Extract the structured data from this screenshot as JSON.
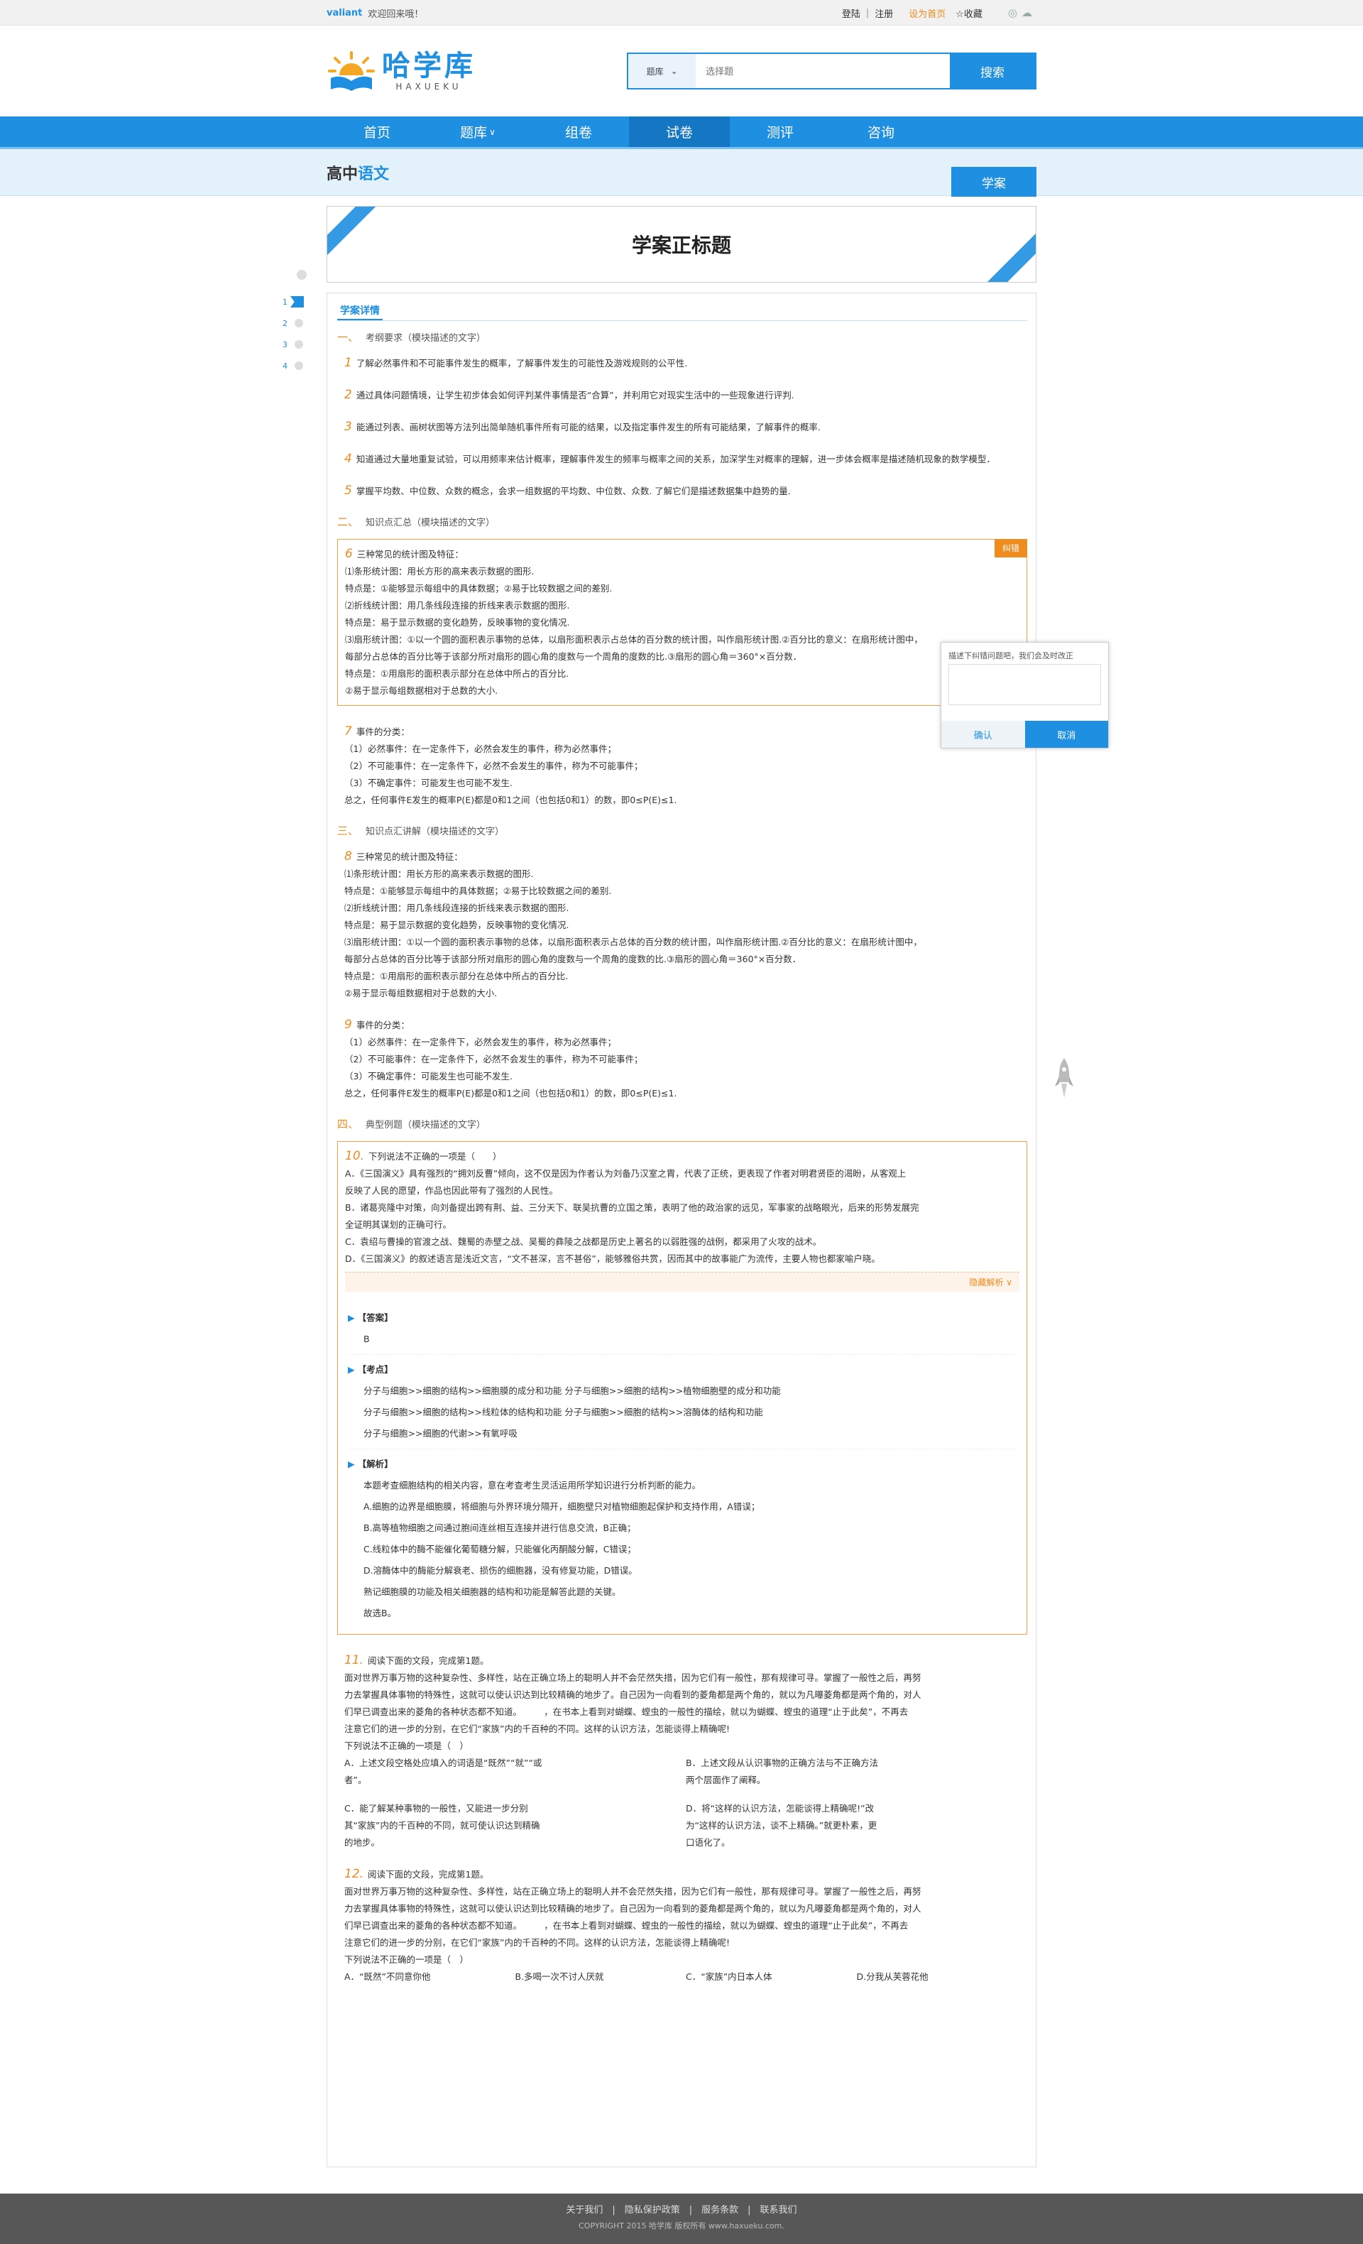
{
  "topbar": {
    "username": "valiant",
    "welcome": "欢迎回来哦！",
    "login": "登陆",
    "register": "注册",
    "set_home": "设为首页",
    "favorite": "☆收藏"
  },
  "logo": {
    "cn": "哈学库",
    "en": "HAXUEKU"
  },
  "search": {
    "type": "题库",
    "placeholder": "选择题",
    "button": "搜索"
  },
  "nav": [
    "首页",
    "题库",
    "组卷",
    "试卷",
    "测评",
    "咨询"
  ],
  "subbar": {
    "crumb_main": "高中",
    "crumb_sub": "语文",
    "tab": "学案"
  },
  "page_title": "学案正标题",
  "section_tab": "学案详情",
  "sections": {
    "s1": {
      "num": "一、",
      "text": "考纲要求（模块描述的文字）"
    },
    "s2": {
      "num": "二、",
      "text": "知识点汇总（模块描述的文字）"
    },
    "s3": {
      "num": "三、",
      "text": "知识点汇讲解（模块描述的文字）"
    },
    "s4": {
      "num": "四、",
      "text": "典型例题（模块描述的文字）"
    }
  },
  "req": [
    {
      "n": "1",
      "t": "了解必然事件和不可能事件发生的概率，了解事件发生的可能性及游戏规则的公平性."
    },
    {
      "n": "2",
      "t": "通过具体问题情境，让学生初步体会如何评判某件事情是否“合算”，并利用它对现实生活中的一些现象进行评判."
    },
    {
      "n": "3",
      "t": "能通过列表、画树状图等方法列出简单随机事件所有可能的结果，以及指定事件发生的所有可能结果，了解事件的概率."
    },
    {
      "n": "4",
      "t": "知道通过大量地重复试验，可以用频率来估计概率，理解事件发生的频率与概率之间的关系，加深学生对概率的理解，进一步体会概率是描述随机现象的数学模型．"
    },
    {
      "n": "5",
      "t": "掌握平均数、中位数、众数的概念，会求一组数据的平均数、中位数、众数. 了解它们是描述数据集中趋势的量."
    }
  ],
  "kp6": {
    "n": "6",
    "lines": [
      "三种常见的统计图及特征：",
      "⑴条形统计图：用长方形的高来表示数据的图形.",
      "特点是：①能够显示每组中的具体数据；②易于比较数据之间的差别.",
      "⑵折线统计图：用几条线段连接的折线来表示数据的图形.",
      "特点是：易于显示数据的变化趋势，反映事物的变化情况.",
      "⑶扇形统计图：①以一个圆的面积表示事物的总体，以扇形面积表示占总体的百分数的统计图，叫作扇形统计图.②百分比的意义：在扇形统计图中，",
      "每部分占总体的百分比等于该部分所对扇形的圆心角的度数与一个周角的度数的比.③扇形的圆心角＝360°×百分数．",
      "特点是：①用扇形的面积表示部分在总体中所占的百分比.",
      "②易于显示每组数据相对于总数的大小."
    ]
  },
  "correct_tag": "纠错",
  "popup": {
    "text": "描述下纠错问题吧，我们会及时改正",
    "ok": "确认",
    "cancel": "取消"
  },
  "kp7": {
    "n": "7",
    "lines": [
      "事件的分类：",
      "（1）必然事件：在一定条件下，必然会发生的事件，称为必然事件；",
      "（2）不可能事件：在一定条件下，必然不会发生的事件，称为不可能事件；",
      "（3）不确定事件：可能发生也可能不发生.",
      "总之，任何事件E发生的概率P(E)都是0和1之间（也包括0和1）的数，即0≤P(E)≤1."
    ]
  },
  "kp8": {
    "n": "8",
    "lines": [
      "三种常见的统计图及特征：",
      "⑴条形统计图：用长方形的高来表示数据的图形.",
      "特点是：①能够显示每组中的具体数据；②易于比较数据之间的差别.",
      "⑵折线统计图：用几条线段连接的折线来表示数据的图形.",
      "特点是：易于显示数据的变化趋势，反映事物的变化情况.",
      "⑶扇形统计图：①以一个圆的面积表示事物的总体，以扇形面积表示占总体的百分数的统计图，叫作扇形统计图.②百分比的意义：在扇形统计图中，",
      "每部分占总体的百分比等于该部分所对扇形的圆心角的度数与一个周角的度数的比.③扇形的圆心角＝360°×百分数．",
      "特点是：①用扇形的面积表示部分在总体中所占的百分比.",
      "②易于显示每组数据相对于总数的大小."
    ]
  },
  "kp9": {
    "n": "9",
    "lines": [
      "事件的分类：",
      "（1）必然事件：在一定条件下，必然会发生的事件，称为必然事件；",
      "（2）不可能事件：在一定条件下，必然不会发生的事件，称为不可能事件；",
      "（3）不确定事件：可能发生也可能不发生.",
      "总之，任何事件E发生的概率P(E)都是0和1之间（也包括0和1）的数，即0≤P(E)≤1."
    ]
  },
  "q10": {
    "n": "10.",
    "stem": "下列说法不正确的一项是（　　）",
    "lines": [
      "A．《三国演义》具有强烈的“拥刘反曹”倾向，这不仅是因为作者认为刘备乃汉室之胄，代表了正统，更表现了作者对明君贤臣的渴盼，从客观上",
      "反映了人民的愿望，作品也因此带有了强烈的人民性。",
      "B．诸葛亮隆中对策，向刘备提出跨有荆、益、三分天下、联吴抗曹的立国之策，表明了他的政治家的远见，军事家的战略眼光，后来的形势发展完",
      "全证明其谋划的正确可行。",
      "C．袁绍与曹操的官渡之战、魏蜀的赤壁之战、吴蜀的彝陵之战都是历史上著名的以弱胜强的战例，都采用了火攻的战术。",
      "D．《三国演义》的叙述语言是浅近文言，“文不甚深，言不甚俗”，能够雅俗共赏，因而其中的故事能广为流传，主要人物也都家喻户晓。"
    ],
    "toggle": "隐藏解析 ∨",
    "answer_head": "【答案】",
    "answer": "B",
    "point_head": "【考点】",
    "points": [
      "分子与细胞>>细胞的结构>>细胞膜的成分和功能 分子与细胞>>细胞的结构>>植物细胞壁的成分和功能",
      "分子与细胞>>细胞的结构>>线粒体的结构和功能 分子与细胞>>细胞的结构>>溶酶体的结构和功能",
      "分子与细胞>>细胞的代谢>>有氧呼吸"
    ],
    "analysis_head": "【解析】",
    "analysis": [
      "本题考查细胞结构的相关内容，意在考查考生灵活运用所学知识进行分析判断的能力。",
      "A.细胞的边界是细胞膜，将细胞与外界环境分隔开，细胞壁只对植物细胞起保护和支持作用，A错误；",
      "B.高等植物细胞之间通过胞间连丝相互连接并进行信息交流，B正确；",
      "C.线粒体中的酶不能催化葡萄糖分解，只能催化丙酮酸分解，C错误；",
      "D.溶酶体中的酶能分解衰老、损伤的细胞器，没有修复功能，D错误。",
      "熟记细胞膜的功能及相关细胞器的结构和功能是解答此题的关键。",
      "故选B。"
    ]
  },
  "q11": {
    "n": "11.",
    "stem": "阅读下面的文段，完成第1题。",
    "para": [
      "面对世界万事万物的这种复杂性、多样性，站在正确立场上的聪明人并不会茫然失措，因为它们有一般性，那有规律可寻。掌握了一般性之后，再努",
      "力去掌握具体事物的特殊性，这就可以使认识达到比较精确的地步了。自己因为一向看到的菱角都是两个角的，就以为凡曝菱角都是两个角的，对人",
      "们早已调查出来的菱角的各种状态都不知道。　　　，在书本上看到对蝴蝶、螳虫的一般性的描绘，就以为蝴蝶、螳虫的道理“止于此矣”，不再去",
      "注意它们的进一步的分别，在它们“家族”内的千百种的不同。这样的认识方法，怎能谈得上精确呢!"
    ],
    "question": "下列说法不正确的一项是（　）",
    "opts": [
      "A．上述文段空格处应填入的词语是“既然”“就”“或者”。",
      "B．上述文段从认识事物的正确方法与不正确方法两个层面作了阐释。",
      "C．能了解某种事物的一般性，又能进一步分别其“家族”内的千百种的不同，就可使认识达到精确的地步。",
      "D．将“这样的认识方法，怎能谈得上精确呢!”改为“这样的认识方法，谈不上精确。”就更朴素，更口语化了。"
    ]
  },
  "q12": {
    "n": "12.",
    "stem": "阅读下面的文段，完成第1题。",
    "para": [
      "面对世界万事万物的这种复杂性、多样性，站在正确立场上的聪明人并不会茫然失措，因为它们有一般性，那有规律可寻。掌握了一般性之后，再努",
      "力去掌握具体事物的特殊性，这就可以使认识达到比较精确的地步了。自己因为一向看到的菱角都是两个角的，就以为凡曝菱角都是两个角的，对人",
      "们早已调查出来的菱角的各种状态都不知道。　　　，在书本上看到对蝴蝶、螳虫的一般性的描绘，就以为蝴蝶、螳虫的道理“止于此矣”，不再去",
      "注意它们的进一步的分别，在它们“家族”内的千百种的不同。这样的认识方法，怎能谈得上精确呢!"
    ],
    "question": "下列说法不正确的一项是（　）",
    "opts": [
      "A．“既然”不同意你他",
      "B.多喝一次不讨人厌就",
      "C．“家族”内日本人体",
      "D.分我从芙蓉花他"
    ]
  },
  "side_nav": [
    "1",
    "2",
    "3",
    "4"
  ],
  "footer": {
    "links": "关于我们　|　隐私保护政策　|　服务条款　|　联系我们",
    "copyright": "COPYRIGHT 2015  哈学库  版权所有  www.haxueku.com."
  }
}
